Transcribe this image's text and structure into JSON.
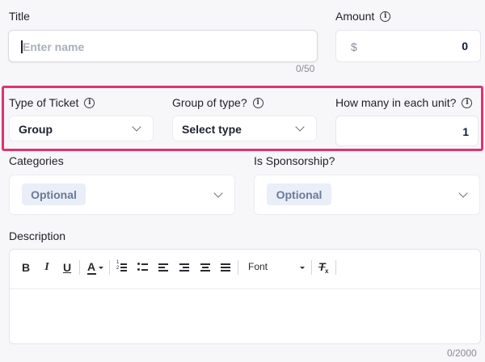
{
  "title_field": {
    "label": "Title",
    "placeholder": "Enter name",
    "counter": "0/50"
  },
  "amount_field": {
    "label": "Amount",
    "currency": "$",
    "value": "0"
  },
  "ticket_type": {
    "label": "Type of Ticket",
    "value": "Group"
  },
  "group_type": {
    "label": "Group of type?",
    "value": "Select type"
  },
  "unit_count": {
    "label": "How many in each unit?",
    "value": "1"
  },
  "categories": {
    "label": "Categories",
    "chip": "Optional"
  },
  "sponsorship": {
    "label": "Is Sponsorship?",
    "chip": "Optional"
  },
  "description": {
    "label": "Description",
    "counter": "0/2000",
    "toolbar": {
      "bold": "B",
      "italic": "I",
      "underline": "U",
      "text_color": "A",
      "font": "Font",
      "clear": "T"
    }
  },
  "colors": {
    "highlight": "#e0336f",
    "accent_text": "#0d1a3a",
    "chip_bg": "#e9eef9"
  }
}
